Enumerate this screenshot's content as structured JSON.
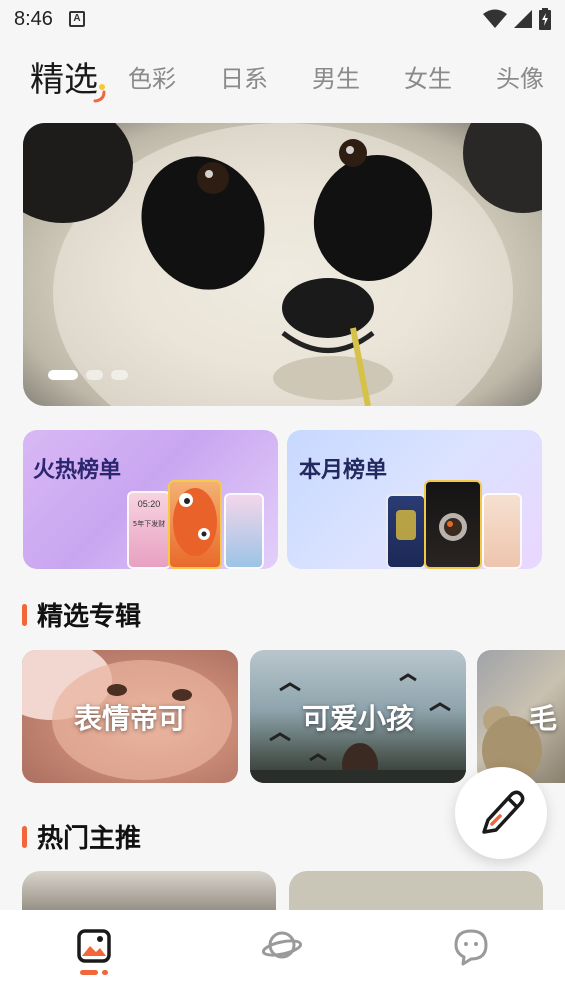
{
  "status_bar": {
    "time": "8:46",
    "app_icon_letter": "A"
  },
  "tabs": [
    {
      "label": "精选",
      "active": true
    },
    {
      "label": "色彩",
      "active": false
    },
    {
      "label": "日系",
      "active": false
    },
    {
      "label": "男生",
      "active": false
    },
    {
      "label": "女生",
      "active": false
    },
    {
      "label": "头像",
      "active": false
    }
  ],
  "banner": {
    "subject": "panda",
    "slide_count": 3,
    "active_slide": 1
  },
  "rankings": {
    "hot": {
      "title": "火热榜单",
      "phone_text_time": "05:20",
      "phone_text_caption": "5年下发财"
    },
    "month": {
      "title": "本月榜单"
    }
  },
  "featured_albums": {
    "title": "精选专辑",
    "items": [
      {
        "label": "表情帝可"
      },
      {
        "label": "可爱小孩"
      },
      {
        "label": "毛"
      }
    ]
  },
  "hot_recommend": {
    "title": "热门主推"
  },
  "bottom_nav": {
    "items": [
      {
        "icon": "gallery-icon",
        "active": true
      },
      {
        "icon": "planet-icon",
        "active": false
      },
      {
        "icon": "chat-bubble-icon",
        "active": false
      }
    ]
  },
  "colors": {
    "accent": "#f2673a",
    "background": "#f6f6f7",
    "tab_inactive": "#8a8a8a"
  },
  "fab": {
    "icon": "pen-icon"
  }
}
